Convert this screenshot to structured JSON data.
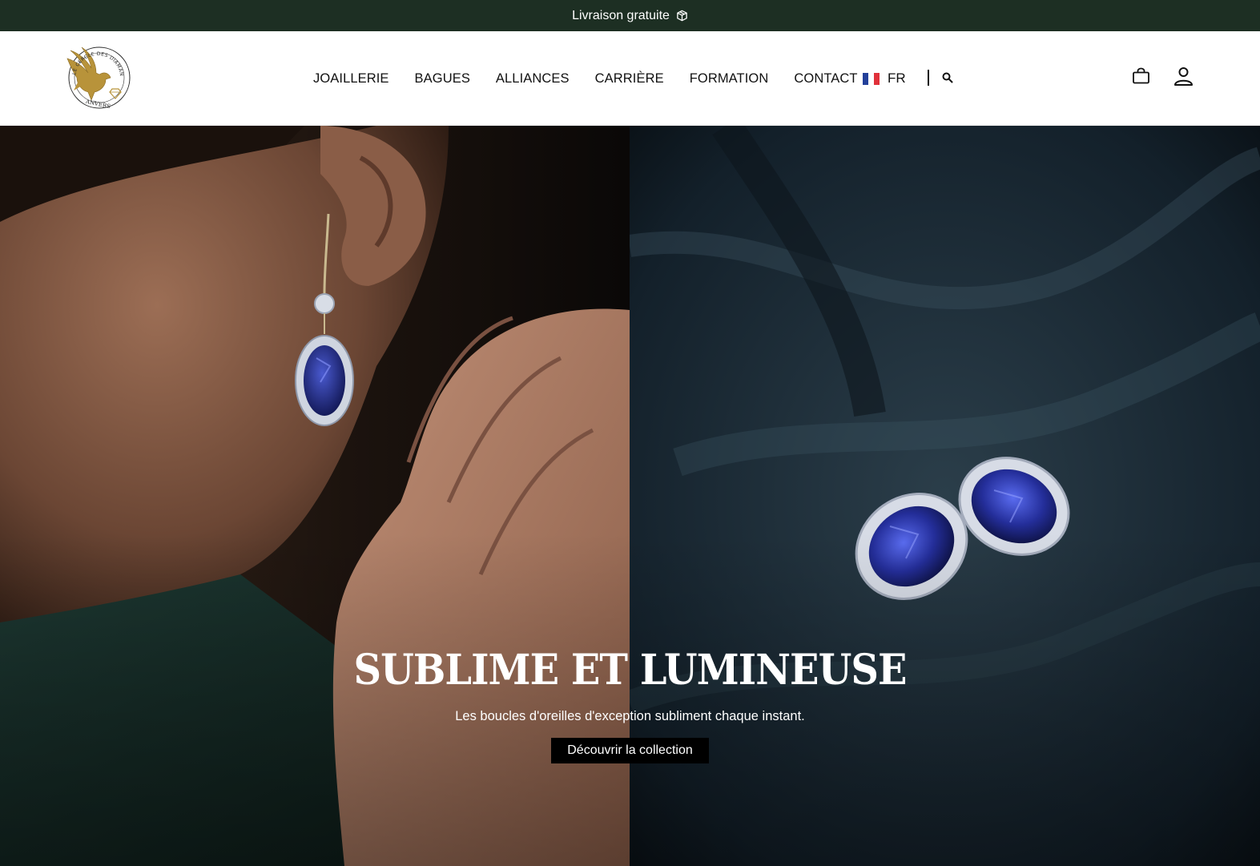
{
  "announcement": {
    "text": "Livraison gratuite",
    "icon": "package-icon"
  },
  "header": {
    "logo": {
      "ring_text": "LE CERCLE DES DIAMANTAIRES",
      "city": "ANVERS",
      "icon": "eagle-logo",
      "colors": {
        "gold": "#b8933a",
        "ring": "#2a2a2a"
      }
    },
    "nav": [
      {
        "label": "JOAILLERIE"
      },
      {
        "label": "BAGUES"
      },
      {
        "label": "ALLIANCES"
      },
      {
        "label": "CARRIÈRE"
      },
      {
        "label": "FORMATION"
      },
      {
        "label": "CONTACT"
      }
    ],
    "language": {
      "code": "FR",
      "icon": "french-flag-icon",
      "flag_colors": [
        "#23409a",
        "#ffffff",
        "#e0303a"
      ]
    },
    "search_icon": "search-icon",
    "cart_icon": "shopping-bag-icon",
    "account_icon": "user-icon"
  },
  "hero": {
    "title": "SUBLIME ET LUMINEUSE",
    "subtitle": "Les boucles d'oreilles d'exception subliment chaque instant.",
    "cta_label": "Découvrir la collection",
    "left_image": "woman-wearing-sapphire-drop-earring",
    "right_image": "sapphire-stud-earrings-on-dark-silk"
  },
  "colors": {
    "announcement_bg": "#1d2f23",
    "header_bg": "#ffffff",
    "text": "#111111",
    "cta_bg": "#000000",
    "sapphire": "#1f2a86"
  }
}
